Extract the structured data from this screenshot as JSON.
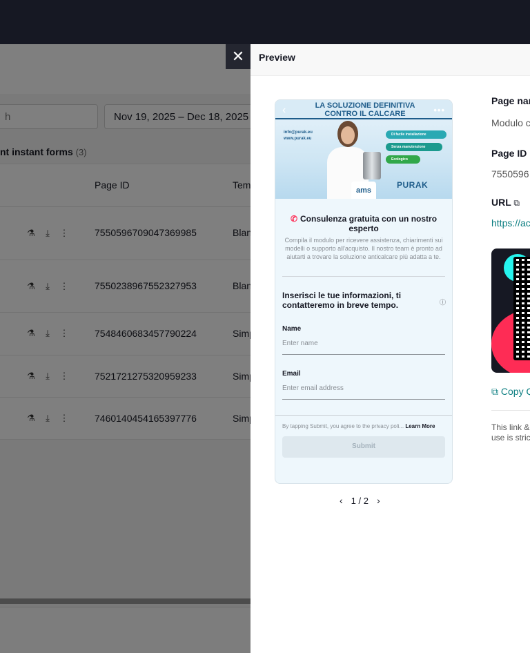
{
  "background": {
    "search_partial": "h",
    "date_range": "Nov 19, 2025 – Dec 18, 2025",
    "section_title": "nt instant forms",
    "section_count": "(3)",
    "columns": {
      "page_id": "Page ID",
      "template": "Tem"
    },
    "rows": [
      {
        "page_id": "7550596709047369985",
        "template": "Blan"
      },
      {
        "page_id": "7550238967552327953",
        "template": "Blan"
      },
      {
        "page_id": "7548460683457790224",
        "template": "Simp"
      },
      {
        "page_id": "7521721275320959233",
        "template": "Simp"
      },
      {
        "page_id": "7460140454165397776",
        "template": "Simp"
      }
    ],
    "row_icons": [
      "flask-icon",
      "download-icon",
      "more-vertical-icon"
    ]
  },
  "drawer": {
    "title": "Preview",
    "close_icon": "close-icon"
  },
  "preview": {
    "banner": {
      "title_line1": "LA SOLUZIONE DEFINITIVA",
      "title_line2": "CONTRO IL CALCARE",
      "email": "info@purak.eu",
      "website": "www.purak.eu",
      "pill1": "Di facile installazione",
      "pill2": "Senza manutenzione",
      "pill3": "Ecologico",
      "ams": "ams",
      "purak": "PURAK"
    },
    "intro_title": "Consulenza gratuita con un nostro esperto",
    "intro_desc": "Compila il modulo per ricevere assistenza, chiarimenti sui modelli o supporto all'acquisto. Il nostro team è pronto ad aiutarti a trovare la soluzione anticalcare più adatta a te.",
    "info_heading": "Inserisci le tue informazioni, ti contatteremo in breve tempo.",
    "fields": [
      {
        "label": "Name",
        "placeholder": "Enter name"
      },
      {
        "label": "Email",
        "placeholder": "Enter email address"
      }
    ],
    "consent_text": "By tapping Submit, you agree to the privacy poli...",
    "learn_more": "Learn More",
    "submit": "Submit",
    "pager": {
      "text": "1 / 2"
    }
  },
  "details": {
    "page_name_label": "Page nar",
    "page_name_value": "Modulo c",
    "page_id_label": "Page ID",
    "page_id_value": "7550596",
    "url_label": "URL",
    "url_value": "https://ac",
    "copy_label": "Copy Q",
    "disclaimer_line1": "This link &",
    "disclaimer_line2": "use is stric"
  },
  "colors": {
    "accent": "#0a7d80",
    "brand_pink": "#fe2c55",
    "brand_cyan": "#25f4ee",
    "dark": "#161823"
  }
}
